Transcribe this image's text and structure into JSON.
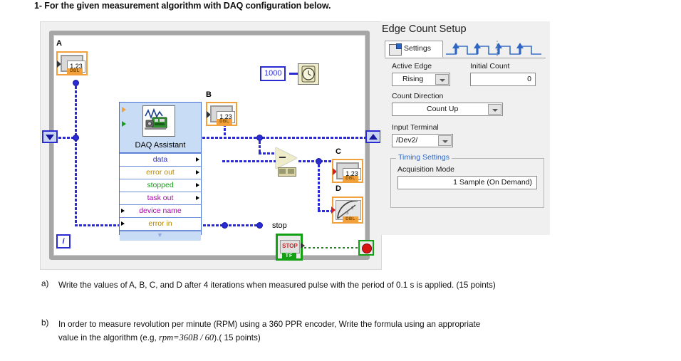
{
  "question": {
    "heading": "1- For the given measurement algorithm with DAQ configuration below.",
    "items": [
      {
        "marker": "a)",
        "text": "Write the values of A, B, C, and D after 4 iterations when measured pulse with the period of 0.1 s is applied. (15 points)"
      },
      {
        "marker": "b)",
        "text": "In order to measure revolution per minute (RPM) using a 360 PPR encoder, Write the formula using an appropriate"
      },
      {
        "marker": "",
        "text_prefix": "value in the algorithm (e.g, ",
        "formula_lhs": "rpm",
        "formula_eq": "=",
        "formula_rhs": "360B / 60",
        "text_suffix": ").( 15 points)"
      }
    ]
  },
  "block_diagram": {
    "labels": {
      "a": "A",
      "b": "B",
      "c": "C",
      "d": "D",
      "stop": "stop"
    },
    "indicator_type_tag": "DBL",
    "indicator_value": "1.23",
    "daq_assistant": {
      "title": "DAQ Assistant",
      "terminals": [
        {
          "name": "data",
          "color": "#2b2bd4",
          "side": "out"
        },
        {
          "name": "error out",
          "color": "#b58900",
          "side": "out"
        },
        {
          "name": "stopped",
          "color": "#18a018",
          "side": "out"
        },
        {
          "name": "task out",
          "color": "#b000b0",
          "side": "out"
        },
        {
          "name": "device name",
          "color": "#b000b0",
          "side": "in"
        },
        {
          "name": "error in",
          "color": "#b58900",
          "side": "in"
        }
      ],
      "icon_name": "daq-device-icon"
    },
    "wait_constant": "1000",
    "wait_icon_name": "wait-ms-clock-icon",
    "subtract_icon_name": "subtract-function-icon",
    "stop_button_label": "STOP",
    "stop_button_tag": "TF",
    "loop_condition_icon": "stop-if-true-icon",
    "iteration_terminal": "i",
    "shift_register_left_icon": "shift-register-down-icon",
    "shift_register_right_icon": "shift-register-up-icon",
    "gauge_icon_name": "gauge-indicator-icon"
  },
  "config_panel": {
    "title": "Edge Count Setup",
    "tab": {
      "label": "Settings",
      "icon_name": "settings-properties-icon",
      "waveform_icon_name": "edge-count-waveform-icon"
    },
    "fields": {
      "active_edge": {
        "label": "Active Edge",
        "value": "Rising"
      },
      "initial_count": {
        "label": "Initial Count",
        "value": "0"
      },
      "count_direction": {
        "label": "Count Direction",
        "value": "Count Up"
      },
      "input_terminal": {
        "label": "Input Terminal",
        "value": "/Dev2/"
      }
    },
    "timing_settings": {
      "group_label": "Timing Settings",
      "acquisition_mode": {
        "label": "Acquisition Mode",
        "value": "1 Sample (On Demand)"
      }
    },
    "accent_color": "#2b66c4"
  }
}
